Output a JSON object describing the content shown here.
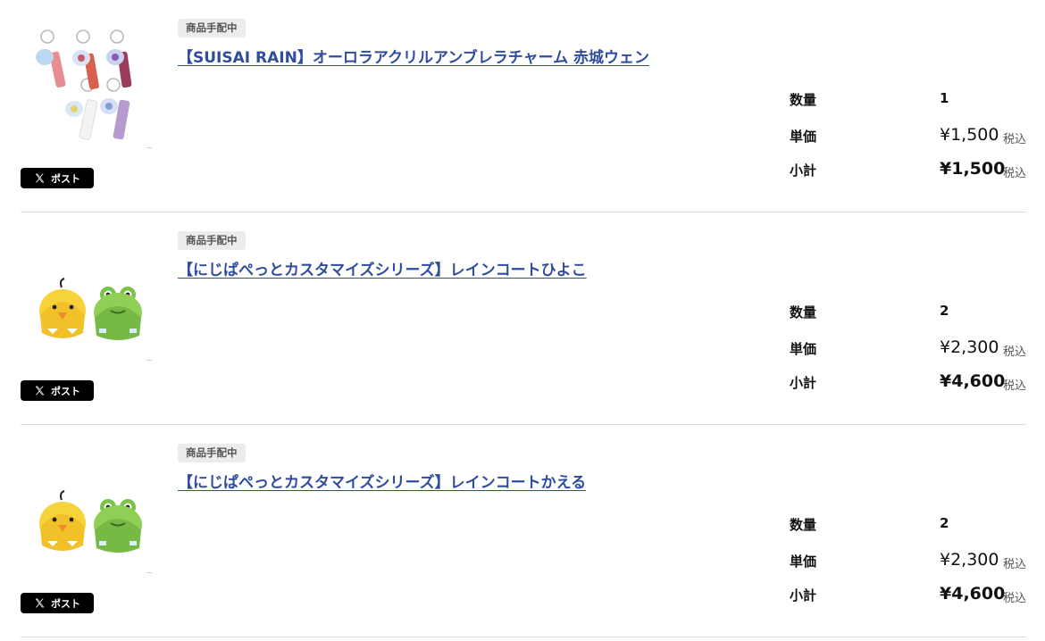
{
  "post_label": "ポスト",
  "labels": {
    "quantity": "数量",
    "unit_price": "単価",
    "subtotal": "小計",
    "tax_included": "税込"
  },
  "items": [
    {
      "status": "商品手配中",
      "title": "【SUISAI RAIN】オーロラアクリルアンブレラチャーム 赤城ウェン",
      "quantity": "1",
      "unit_price": "¥1,500",
      "subtotal": "¥1,500",
      "image": "acrylic-umbrella-charms"
    },
    {
      "status": "商品手配中",
      "title": "【にじぱぺっとカスタマイズシリーズ】レインコートひよこ",
      "quantity": "2",
      "unit_price": "¥2,300",
      "subtotal": "¥4,600",
      "image": "chick-and-frog-raincoats"
    },
    {
      "status": "商品手配中",
      "title": "【にじぱぺっとカスタマイズシリーズ】レインコートかえる",
      "quantity": "2",
      "unit_price": "¥2,300",
      "subtotal": "¥4,600",
      "image": "chick-and-frog-raincoats"
    }
  ]
}
